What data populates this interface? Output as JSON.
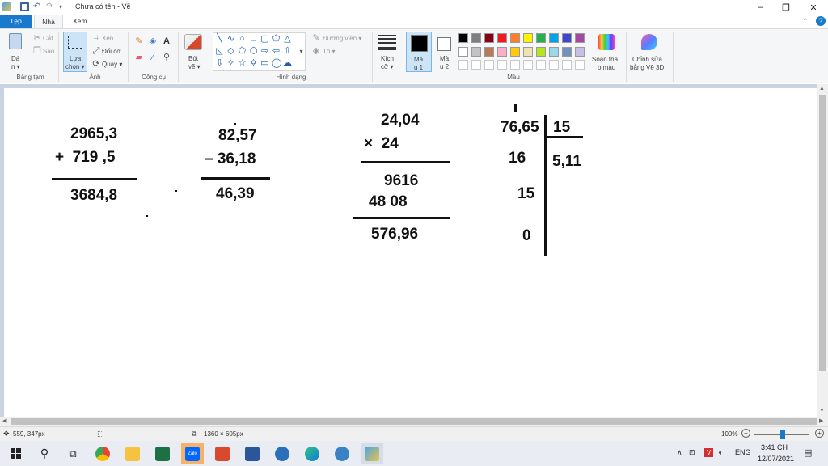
{
  "titlebar": {
    "title": "Chưa có tên - Vẽ",
    "controls": [
      "–",
      "❐",
      "✕"
    ]
  },
  "tabs": {
    "file": "Tệp",
    "home": "Nhà",
    "view": "Xem"
  },
  "ribbon": {
    "clipboard": {
      "paste": "Dá\nn ▾",
      "paste_line1": "Dá",
      "paste_line2": "n ▾",
      "cut": "Cắt",
      "copy": "Sao",
      "label": "Bảng tạm"
    },
    "image": {
      "select_line1": "Lựa",
      "select_line2": "chọn ▾",
      "crop": "Xén",
      "resize": "Đổi cỡ",
      "rotate": "Quay ▾",
      "label": "Ảnh"
    },
    "tools": {
      "label": "Công cụ"
    },
    "brushes": {
      "line1": "Bút",
      "line2": "vẽ ▾"
    },
    "shapes": {
      "outline": "Đường viền ▾",
      "fill": "Tô ▾",
      "label": "Hình dạng"
    },
    "size": {
      "line1": "Kích",
      "line2": "cỡ ▾"
    },
    "color1": {
      "line1": "Mà",
      "line2": "u 1"
    },
    "color2": {
      "line1": "Mà",
      "line2": "u 2"
    },
    "colors": {
      "label": "Màu",
      "edit_line1": "Soạn thả",
      "edit_line2": "o màu"
    },
    "paint3d": {
      "line1": "Chỉnh sửa",
      "line2": "bằng Vẽ 3D"
    },
    "palette_row1": [
      "#000000",
      "#7f7f7f",
      "#880015",
      "#ed1c24",
      "#ff7f27",
      "#fff200",
      "#22b14c",
      "#00a2e8",
      "#3f48cc",
      "#a349a4"
    ],
    "palette_row2": [
      "#ffffff",
      "#c3c3c3",
      "#b97a57",
      "#ffaec9",
      "#ffc90e",
      "#efe4b0",
      "#b5e61d",
      "#99d9ea",
      "#7092be",
      "#c8bfe7"
    ]
  },
  "canvas_math": {
    "add": {
      "a": "2965,3",
      "b": "+  719 ,5",
      "result": "3684,8"
    },
    "sub": {
      "a": "82,57",
      "b": "– 36,18",
      "result": "46,39"
    },
    "mul": {
      "a": "24,04",
      "b": "×  24",
      "p1": "9616",
      "p2": "48 08",
      "result": "576,96"
    },
    "div": {
      "dividend": "76,65",
      "divisor": "15",
      "r1": "16",
      "r2": "15",
      "r3": "0",
      "quotient": "5,11"
    }
  },
  "statusbar": {
    "cursor_pos": "559, 347px",
    "canvas_size": "1360 × 605px",
    "zoom": "100%",
    "zoom_level": 1.0
  },
  "taskbar": {
    "lang": "ENG",
    "time": "3:41 CH",
    "date": "12/07/2021",
    "apps": [
      "Zalo"
    ]
  }
}
